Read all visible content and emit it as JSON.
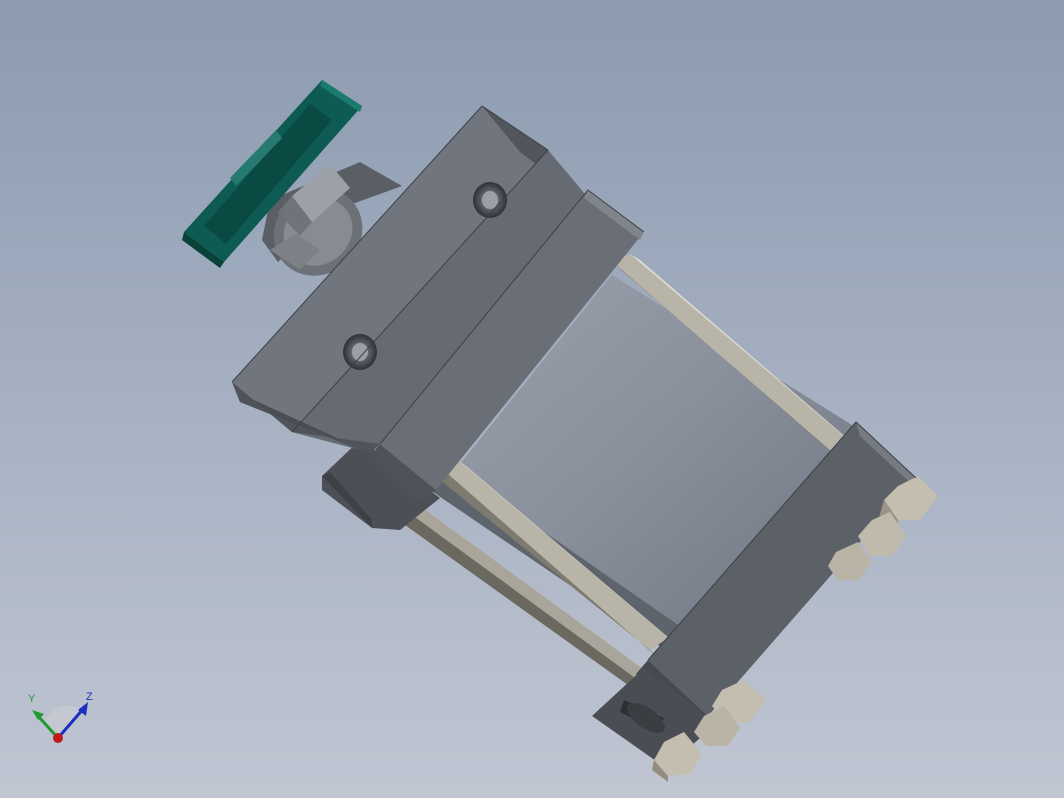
{
  "viewport": {
    "background_top": "#8c9bb0",
    "background_bottom": "#c0c6d2"
  },
  "model": {
    "part_colors": {
      "body": "#6e747c",
      "barrel": "#8a909c",
      "tie_rod": "#b8b4a8",
      "handle": "#0d5b52",
      "nut": "#c4beb0"
    }
  },
  "triad": {
    "x_label": "",
    "y_label": "Y",
    "z_label": "Z",
    "x_color": "#c0191b",
    "y_color": "#1e9a2e",
    "z_color": "#1c2fc0"
  }
}
